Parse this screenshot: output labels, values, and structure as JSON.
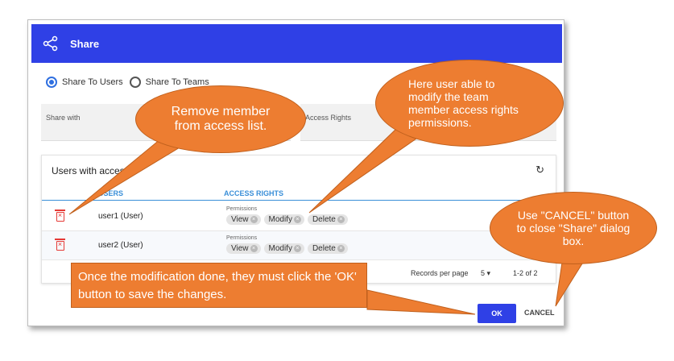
{
  "dialog": {
    "title": "Share",
    "share_to_users": "Share To Users",
    "share_to_teams": "Share To Teams",
    "share_with_label": "Share with",
    "access_rights_label": "Access Rights",
    "users_with_access": "Users with access",
    "col_users": "USERS",
    "col_access_rights": "ACCESS RIGHTS",
    "permissions_label": "Permissions",
    "rows": [
      {
        "user": "user1 (User)",
        "chips": [
          "View",
          "Modify",
          "Delete"
        ]
      },
      {
        "user": "user2 (User)",
        "chips": [
          "View",
          "Modify",
          "Delete"
        ]
      }
    ],
    "records_per_page_label": "Records per page",
    "records_per_page_value": "5",
    "page_range": "1-2 of 2",
    "ok_label": "OK",
    "cancel_label": "CANCEL"
  },
  "callouts": {
    "remove": "Remove member from access list.",
    "modify": "Here user able to modify the team member access rights permissions.",
    "cancel": "Use \"CANCEL\" button to close \"Share\" dialog box.",
    "ok": "Once the modification done, they must click the 'OK' button to save the changes."
  },
  "colors": {
    "header": "#2f40e6",
    "callout": "#ed7d31",
    "delete": "#e53935",
    "accent": "#3a8fd8"
  }
}
